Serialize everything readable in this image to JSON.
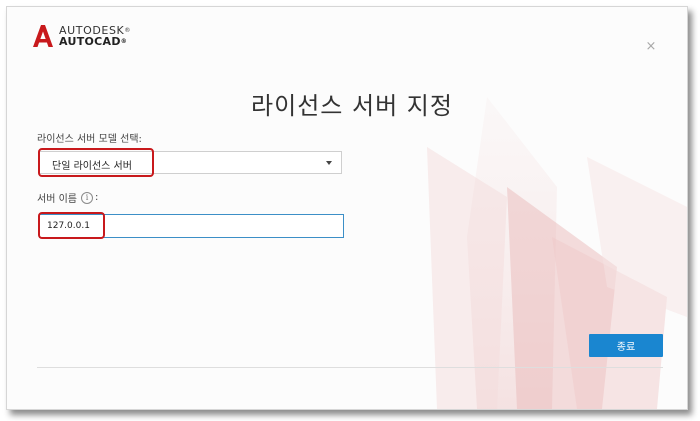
{
  "header": {
    "brand": "AUTODESK",
    "product": "AUTOCAD",
    "registered_mark": "®",
    "logo_icon": "autodesk-a-logo"
  },
  "dialog": {
    "title": "라이선스 서버 지정",
    "close_glyph": "×"
  },
  "server_mode": {
    "label": "라이선스 서버 모델 선택:",
    "selected": "단일 라이선스 서버"
  },
  "server_name": {
    "label": "서버 이름",
    "info_glyph": "i",
    "colon": ":",
    "value": "127.0.0.1"
  },
  "footer": {
    "finish_label": "종료"
  },
  "colors": {
    "accent": "#1a86d0",
    "input_border": "#3c8fc7",
    "highlight": "#c8191c"
  }
}
